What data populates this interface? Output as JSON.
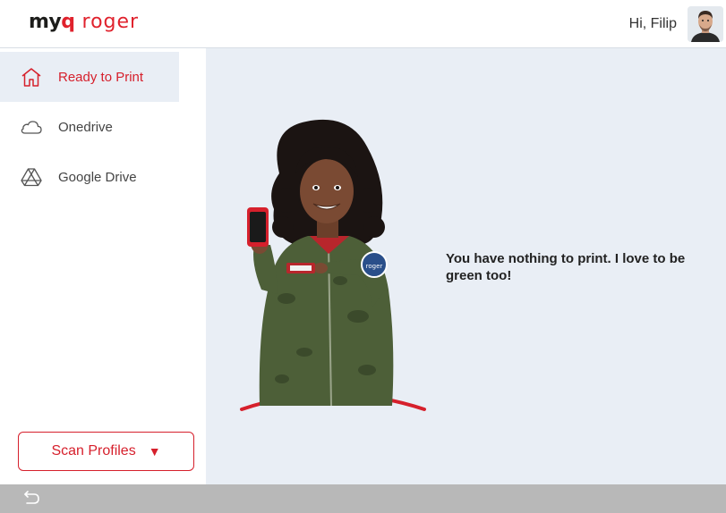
{
  "header": {
    "logo_myq_prefix": "my",
    "logo_myq_q": "q",
    "logo_roger": "roger",
    "greeting": "Hi, Filip",
    "avatar_icon": "user-avatar"
  },
  "sidebar": {
    "items": [
      {
        "label": "Ready to Print",
        "icon": "home-icon",
        "active": true
      },
      {
        "label": "Onedrive",
        "icon": "cloud-icon",
        "active": false
      },
      {
        "label": "Google Drive",
        "icon": "google-drive-icon",
        "active": false
      }
    ],
    "scan_profiles": {
      "label": "Scan Profiles",
      "icon": "caret-down-icon"
    }
  },
  "main": {
    "message": "You have nothing to print. I love to be green too!",
    "illustration": "character-holding-phone",
    "badge_text": "roger"
  },
  "bottom_bar": {
    "back_icon": "back-arrow-icon"
  },
  "colors": {
    "accent": "#d6202c",
    "main_bg": "#e9eef5",
    "bottom_bar": "#b8b8b8",
    "jacket": "#4d5f38"
  }
}
